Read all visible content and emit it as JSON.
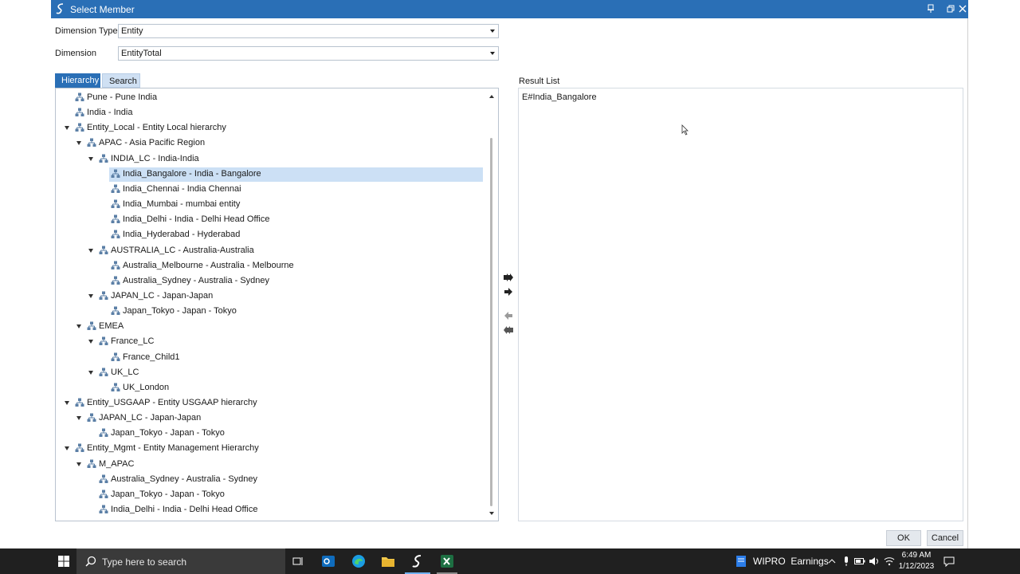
{
  "window": {
    "title": "Select Member"
  },
  "fields": {
    "dimension_type_label": "Dimension Type",
    "dimension_type_value": "Entity",
    "dimension_label": "Dimension",
    "dimension_value": "EntityTotal"
  },
  "tabs": {
    "hierarchy": "Hierarchy",
    "search": "Search"
  },
  "tree": {
    "selected_index": 5,
    "rows": [
      {
        "label": "Pune - Pune India",
        "level": 1,
        "expandable": false
      },
      {
        "label": "India - India",
        "level": 1,
        "expandable": false
      },
      {
        "label": "Entity_Local - Entity Local hierarchy",
        "level": 1,
        "expandable": true
      },
      {
        "label": "APAC - Asia Pacific Region",
        "level": 2,
        "expandable": true
      },
      {
        "label": "INDIA_LC - India-India",
        "level": 3,
        "expandable": true
      },
      {
        "label": "India_Bangalore - India - Bangalore",
        "level": 4,
        "expandable": false
      },
      {
        "label": "India_Chennai - India Chennai",
        "level": 4,
        "expandable": false
      },
      {
        "label": "India_Mumbai - mumbai entity",
        "level": 4,
        "expandable": false
      },
      {
        "label": "India_Delhi - India - Delhi Head Office",
        "level": 4,
        "expandable": false
      },
      {
        "label": "India_Hyderabad - Hyderabad",
        "level": 4,
        "expandable": false
      },
      {
        "label": "AUSTRALIA_LC - Australia-Australia",
        "level": 3,
        "expandable": true
      },
      {
        "label": "Australia_Melbourne - Australia - Melbourne",
        "level": 4,
        "expandable": false
      },
      {
        "label": "Australia_Sydney - Australia - Sydney",
        "level": 4,
        "expandable": false
      },
      {
        "label": "JAPAN_LC - Japan-Japan",
        "level": 3,
        "expandable": true
      },
      {
        "label": "Japan_Tokyo - Japan - Tokyo",
        "level": 4,
        "expandable": false
      },
      {
        "label": "EMEA",
        "level": 2,
        "expandable": true
      },
      {
        "label": "France_LC",
        "level": 3,
        "expandable": true
      },
      {
        "label": "France_Child1",
        "level": 4,
        "expandable": false
      },
      {
        "label": "UK_LC",
        "level": 3,
        "expandable": true
      },
      {
        "label": "UK_London",
        "level": 4,
        "expandable": false
      },
      {
        "label": "Entity_USGAAP - Entity USGAAP hierarchy",
        "level": 1,
        "expandable": true
      },
      {
        "label": "JAPAN_LC - Japan-Japan",
        "level": 2,
        "expandable": true
      },
      {
        "label": "Japan_Tokyo - Japan - Tokyo",
        "level": 3,
        "expandable": false
      },
      {
        "label": "Entity_Mgmt - Entity Management Hierarchy",
        "level": 1,
        "expandable": true
      },
      {
        "label": "M_APAC",
        "level": 2,
        "expandable": true
      },
      {
        "label": "Australia_Sydney - Australia - Sydney",
        "level": 3,
        "expandable": false
      },
      {
        "label": "Japan_Tokyo - Japan - Tokyo",
        "level": 3,
        "expandable": false
      },
      {
        "label": "India_Delhi - India - Delhi Head Office",
        "level": 3,
        "expandable": false
      }
    ]
  },
  "result": {
    "label": "Result List",
    "items": [
      "E#India_Bangalore"
    ]
  },
  "buttons": {
    "ok": "OK",
    "cancel": "Cancel"
  },
  "taskbar": {
    "search_placeholder": "Type here to search",
    "notification_text": "WIPRO  Earnings",
    "time": "6:49 AM",
    "date": "1/12/2023"
  },
  "colors": {
    "accent": "#2a6fb6",
    "selection": "#cce0f5",
    "taskbar": "#202020"
  }
}
